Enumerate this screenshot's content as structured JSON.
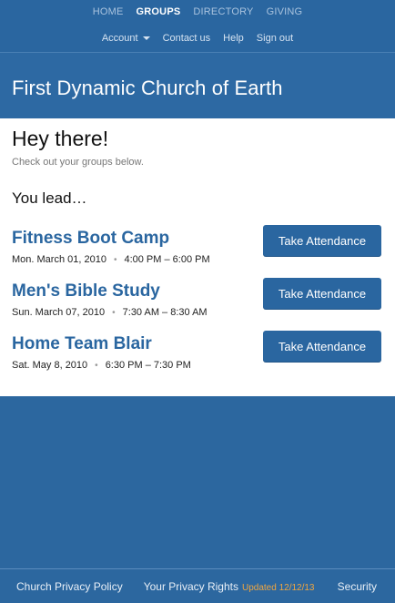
{
  "nav": {
    "primary": [
      {
        "label": "HOME",
        "active": false
      },
      {
        "label": "GROUPS",
        "active": true
      },
      {
        "label": "DIRECTORY",
        "active": false
      },
      {
        "label": "GIVING",
        "active": false
      }
    ],
    "secondary": {
      "account": "Account",
      "contact": "Contact us",
      "help": "Help",
      "signout": "Sign out"
    }
  },
  "banner": {
    "title": "First Dynamic Church of Earth"
  },
  "main": {
    "greeting": "Hey there!",
    "subtext": "Check out your groups below.",
    "section_title": "You lead…",
    "groups": [
      {
        "name": "Fitness Boot Camp",
        "date": "Mon. March 01, 2010",
        "time": "4:00 PM – 6:00 PM",
        "button": "Take Attendance"
      },
      {
        "name": "Men's Bible Study",
        "date": "Sun. March 07, 2010",
        "time": "7:30 AM – 8:30 AM",
        "button": "Take Attendance"
      },
      {
        "name": "Home Team Blair",
        "date": "Sat. May 8, 2010",
        "time": "6:30 PM – 7:30 PM",
        "button": "Take Attendance"
      }
    ],
    "separator": "•"
  },
  "footer": {
    "privacy_policy": "Church Privacy Policy",
    "privacy_rights": "Your Privacy Rights",
    "updated": "Updated 12/12/13",
    "security": "Security"
  },
  "colors": {
    "brand_blue": "#2a66a0",
    "updated_orange": "#f0a640"
  }
}
